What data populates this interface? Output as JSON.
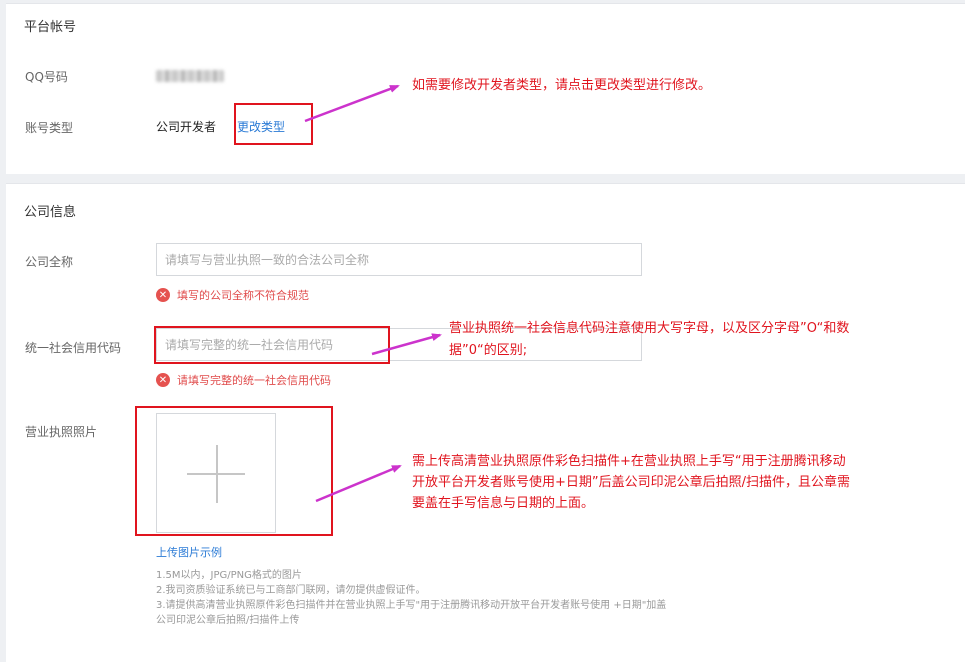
{
  "account": {
    "title": "平台帐号",
    "qq_label": "QQ号码",
    "type_label": "账号类型",
    "type_value": "公司开发者",
    "change_type_link": "更改类型"
  },
  "company": {
    "title": "公司信息",
    "fullname_label": "公司全称",
    "fullname_placeholder": "请填写与营业执照一致的合法公司全称",
    "fullname_error": "填写的公司全称不符合规范",
    "credit_code_label": "统一社会信用代码",
    "credit_code_placeholder": "请填写完整的统一社会信用代码",
    "credit_code_error": "请填写完整的统一社会信用代码",
    "license_label": "营业执照照片",
    "upload_example_link": "上传图片示例",
    "hints": [
      "1.5M以内，JPG/PNG格式的图片",
      "2.我司资质验证系统已与工商部门联网，请勿提供虚假证件。",
      "3.请提供高清营业执照原件彩色扫描件并在营业执照上手写\"用于注册腾讯移动开放平台开发者账号使用 +日期\"加盖",
      "公司印泥公章后拍照/扫描件上传"
    ]
  },
  "annotations": {
    "change_type_note": "如需要修改开发者类型，请点击更改类型进行修改。",
    "credit_code_note_line1": "营业执照统一社会信息代码注意使用大写字母，以及区分字母”O“和数",
    "credit_code_note_line2": "据”0“的区别;",
    "license_note_line1": "需上传高清营业执照原件彩色扫描件+在营业执照上手写“用于注册腾讯移动",
    "license_note_line2": "开放平台开发者账号使用+日期”后盖公司印泥公章后拍照/扫描件，且公章需",
    "license_note_line3": "要盖在手写信息与日期的上面。"
  },
  "colors": {
    "annotation_red": "#e0141e",
    "arrow_magenta": "#cc33cc",
    "link_blue": "#2b7bd6",
    "error_red": "#e04b4b"
  }
}
